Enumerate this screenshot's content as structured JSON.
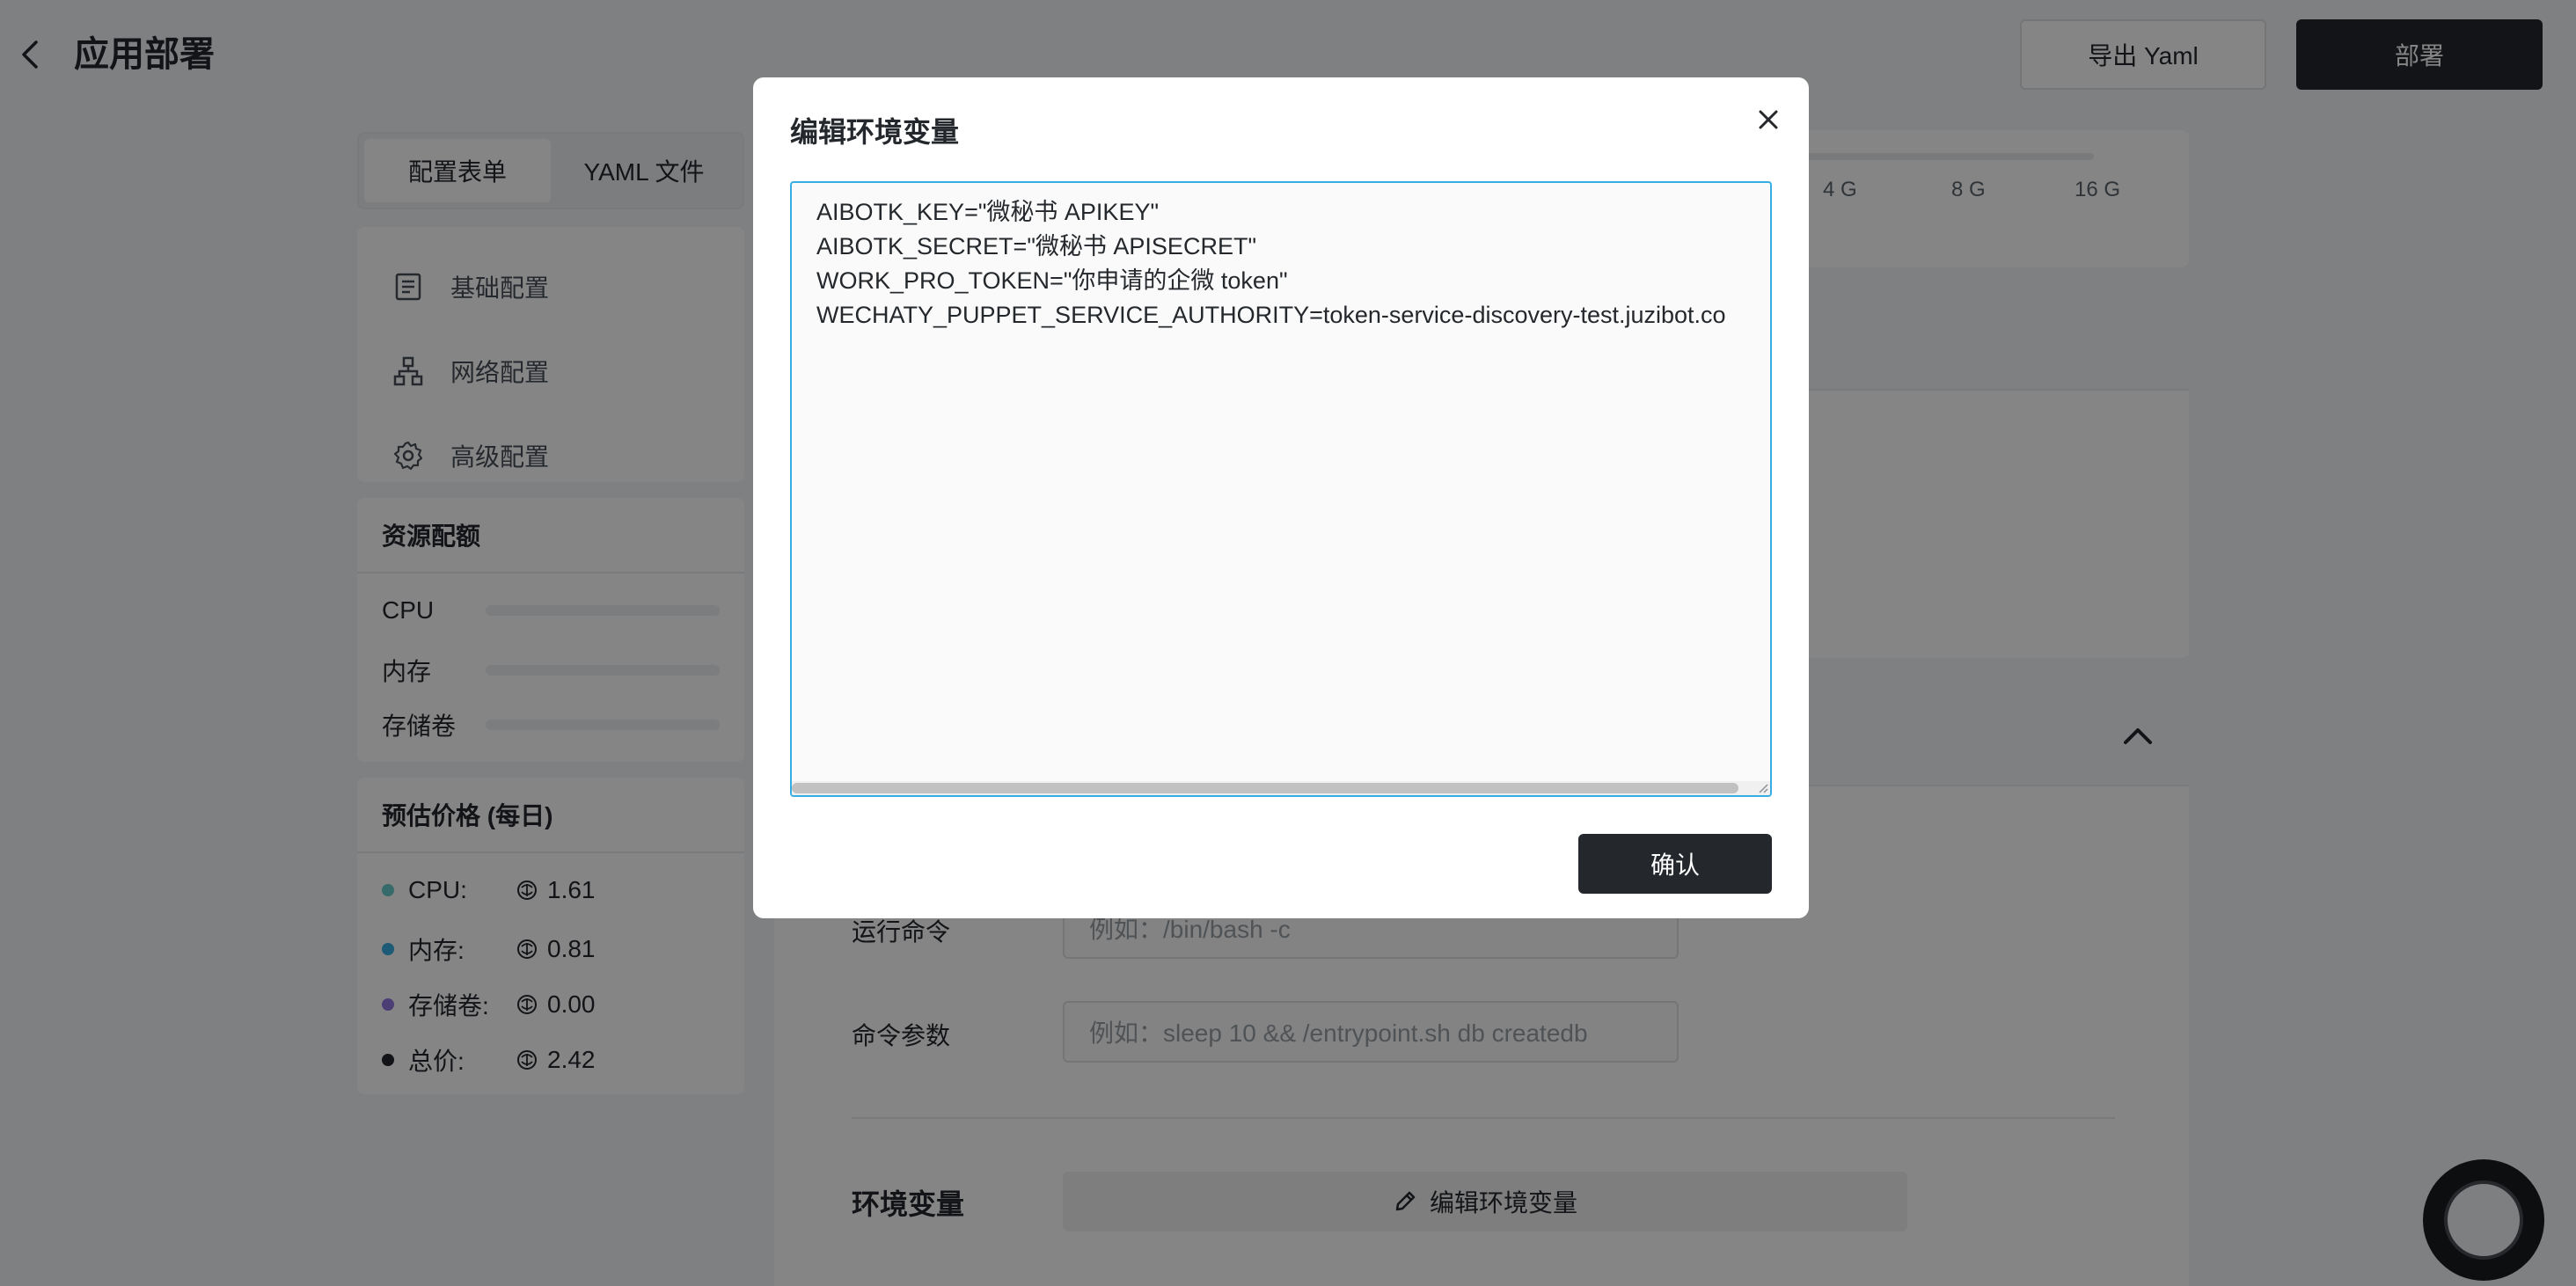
{
  "header": {
    "title": "应用部署",
    "export_label": "导出 Yaml",
    "deploy_label": "部署"
  },
  "sidebar": {
    "tabs": [
      {
        "label": "配置表单",
        "active": true
      },
      {
        "label": "YAML 文件",
        "active": false
      }
    ],
    "nav": [
      {
        "label": "基础配置",
        "icon": "document-icon"
      },
      {
        "label": "网络配置",
        "icon": "network-icon"
      },
      {
        "label": "高级配置",
        "icon": "gear-icon"
      }
    ],
    "resources": {
      "title": "资源配额",
      "rows": [
        {
          "label": "CPU"
        },
        {
          "label": "内存"
        },
        {
          "label": "存储卷"
        }
      ]
    },
    "price": {
      "title": "预估价格 (每日)",
      "rows": [
        {
          "label": "CPU:",
          "value": "1.61",
          "color": "#33bababa"
        },
        {
          "label": "内存:",
          "value": "0.81",
          "color": "#36ade3"
        },
        {
          "label": "存储卷:",
          "value": "0.00",
          "color": "#9077e0"
        },
        {
          "label": "总价:",
          "value": "2.42",
          "color": "#24282c"
        }
      ]
    }
  },
  "main": {
    "memory_ticks": [
      "4 G",
      "8 G",
      "16 G"
    ],
    "command_label": "运行命令",
    "command_placeholder": "例如：/bin/bash -c",
    "args_label": "命令参数",
    "args_placeholder": "例如：sleep 10 && /entrypoint.sh db createdb",
    "env_title": "环境变量",
    "env_edit_label": "编辑环境变量"
  },
  "modal": {
    "title": "编辑环境变量",
    "lines": [
      "AIBOTK_KEY=\"微秘书 APIKEY\"",
      "AIBOTK_SECRET=\"微秘书 APISECRET\"",
      "WORK_PRO_TOKEN=\"你申请的企微 token\"",
      "WECHATY_PUPPET_SERVICE_AUTHORITY=token-service-discovery-test.juzibot.co"
    ],
    "confirm_label": "确认"
  },
  "colors": {
    "primary": "#24282c",
    "focus_border": "#36ade3",
    "overlay": "rgba(0,0,0,0.48)"
  }
}
